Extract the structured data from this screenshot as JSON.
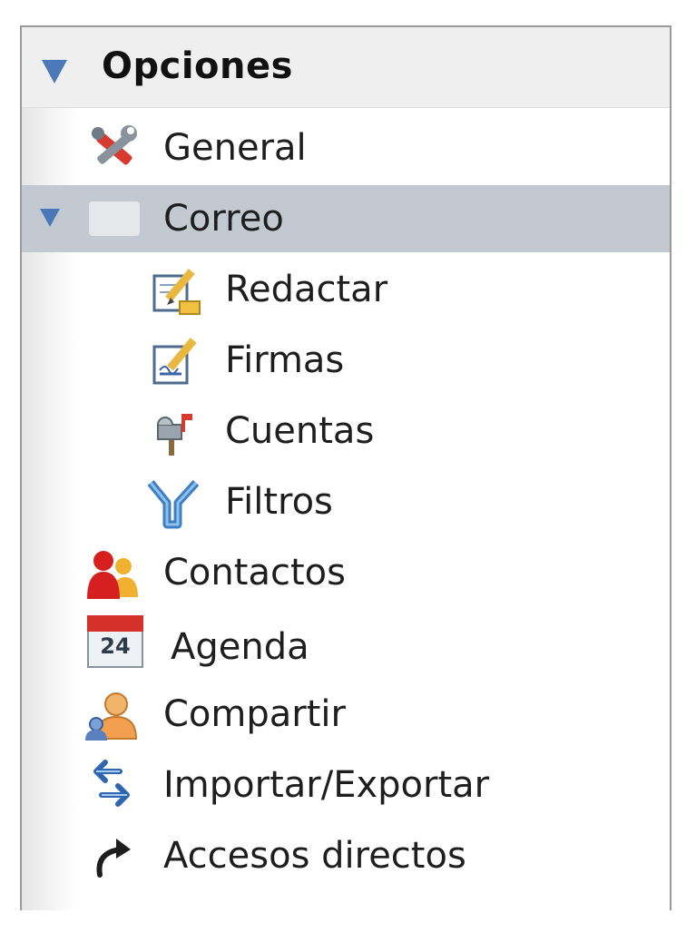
{
  "header": {
    "title": "Opciones"
  },
  "items": [
    {
      "label": "General",
      "icon": "tools-icon"
    },
    {
      "label": "Correo",
      "icon": "mail-folder-icon",
      "selected": true,
      "expanded": true
    },
    {
      "label": "Redactar",
      "icon": "compose-icon"
    },
    {
      "label": "Firmas",
      "icon": "signature-icon"
    },
    {
      "label": "Cuentas",
      "icon": "mailbox-icon"
    },
    {
      "label": "Filtros",
      "icon": "filter-icon"
    },
    {
      "label": "Contactos",
      "icon": "contacts-icon"
    },
    {
      "label": "Agenda",
      "icon": "calendar-icon",
      "calendar_day": "24"
    },
    {
      "label": "Compartir",
      "icon": "share-icon"
    },
    {
      "label": "Importar/Exportar",
      "icon": "import-export-icon"
    },
    {
      "label": "Accesos directos",
      "icon": "shortcut-icon"
    }
  ],
  "colors": {
    "selected_row": "#c3c9d1",
    "header_bg": "#efefef",
    "expander": "#4a78b8"
  }
}
